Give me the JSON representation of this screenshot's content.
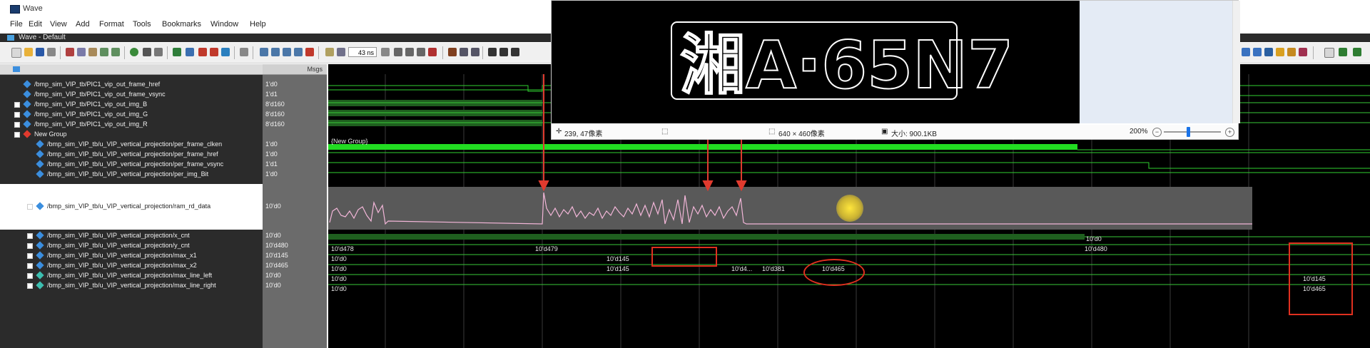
{
  "window": {
    "title": "Wave"
  },
  "menu": [
    "File",
    "Edit",
    "View",
    "Add",
    "Format",
    "Tools",
    "Bookmarks",
    "Window",
    "Help"
  ],
  "pane_title": "Wave - Default",
  "toolbar": {
    "zoom_value": "43 ns"
  },
  "values_header": "Msgs",
  "signals": [
    {
      "name": "/bmp_sim_VIP_tb/PIC1_vip_out_frame_href",
      "value": "1'd0"
    },
    {
      "name": "/bmp_sim_VIP_tb/PIC1_vip_out_frame_vsync",
      "value": "1'd1"
    },
    {
      "name": "/bmp_sim_VIP_tb/PIC1_vip_out_img_B",
      "value": "8'd160"
    },
    {
      "name": "/bmp_sim_VIP_tb/PIC1_vip_out_img_G",
      "value": "8'd160"
    },
    {
      "name": "/bmp_sim_VIP_tb/PIC1_vip_out_img_R",
      "value": "8'd160"
    },
    {
      "name": "New Group",
      "value": ""
    },
    {
      "name": "/bmp_sim_VIP_tb/u_VIP_vertical_projection/per_frame_clken",
      "value": "1'd0"
    },
    {
      "name": "/bmp_sim_VIP_tb/u_VIP_vertical_projection/per_frame_href",
      "value": "1'd0"
    },
    {
      "name": "/bmp_sim_VIP_tb/u_VIP_vertical_projection/per_frame_vsync",
      "value": "1'd1"
    },
    {
      "name": "/bmp_sim_VIP_tb/u_VIP_vertical_projection/per_img_Bit",
      "value": "1'd0"
    },
    {
      "name": "/bmp_sim_VIP_tb/u_VIP_vertical_projection/ram_rd_data",
      "value": "10'd0"
    },
    {
      "name": "/bmp_sim_VIP_tb/u_VIP_vertical_projection/x_cnt",
      "value": "10'd0"
    },
    {
      "name": "/bmp_sim_VIP_tb/u_VIP_vertical_projection/y_cnt",
      "value": "10'd480"
    },
    {
      "name": "/bmp_sim_VIP_tb/u_VIP_vertical_projection/max_x1",
      "value": "10'd145"
    },
    {
      "name": "/bmp_sim_VIP_tb/u_VIP_vertical_projection/max_x2",
      "value": "10'd465"
    },
    {
      "name": "/bmp_sim_VIP_tb/u_VIP_vertical_projection/max_line_left",
      "value": "10'd0"
    },
    {
      "name": "/bmp_sim_VIP_tb/u_VIP_vertical_projection/max_line_right",
      "value": "10'd0"
    }
  ],
  "wave_labels": {
    "group": "{New Group}",
    "x_cnt_end": "10'd0",
    "y_cnt_a": "10'd478",
    "y_cnt_b": "10'd479",
    "y_cnt_c": "10'd480",
    "max_x1_a": "10'd0",
    "max_x1_b": "10'd145",
    "max_x2_a": "10'd0",
    "max_x2_b": "10'd145",
    "max_x2_c": "10'd4...",
    "max_x2_d": "10'd381",
    "max_x2_e": "10'd465",
    "left_a": "10'd0",
    "left_b": "10'd145",
    "right_a": "10'd0",
    "right_b": "10'd465"
  },
  "viewer": {
    "plate_text": "湘A·65N7",
    "status_coords": "239, 47像素",
    "status_dims": "640 × 460像素",
    "status_size": "大小: 900.1KB",
    "zoom": "200%",
    "zoom_out": "−",
    "zoom_in": "+"
  }
}
